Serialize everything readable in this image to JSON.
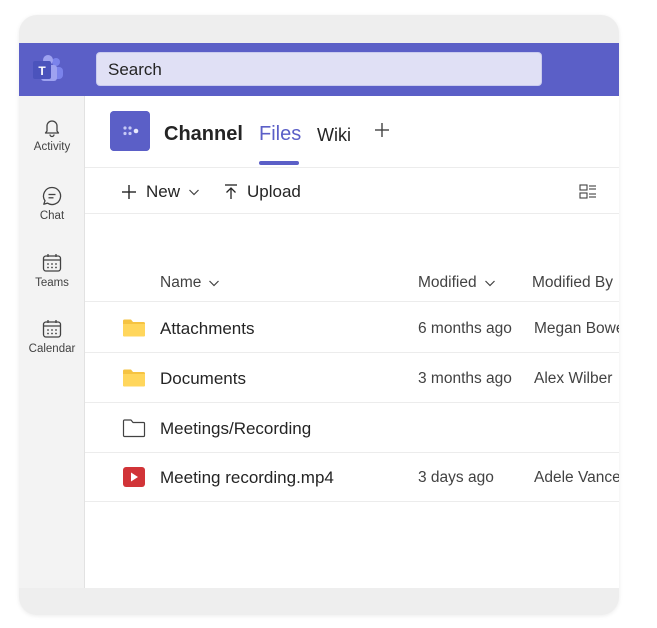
{
  "search": {
    "placeholder": "Search"
  },
  "rail": [
    {
      "label": "Activity",
      "icon": "bell-icon"
    },
    {
      "label": "Chat",
      "icon": "chat-icon"
    },
    {
      "label": "Teams",
      "icon": "teams-icon"
    },
    {
      "label": "Calendar",
      "icon": "calendar-icon"
    }
  ],
  "header": {
    "channel": "Channel",
    "tabs": [
      {
        "label": "Files",
        "active": true
      },
      {
        "label": "Wiki",
        "active": false
      }
    ]
  },
  "toolbar": {
    "new_label": "New",
    "upload_label": "Upload"
  },
  "columns": {
    "name": "Name",
    "modified": "Modified",
    "modified_by": "Modified By"
  },
  "files": [
    {
      "icon": "folder-icon",
      "name": "Attachments",
      "modified": "6 months ago",
      "modified_by": "Megan Bowen"
    },
    {
      "icon": "folder-icon",
      "name": "Documents",
      "modified": "3 months ago",
      "modified_by": "Alex Wilber"
    },
    {
      "icon": "folder-outline-icon",
      "name": "Meetings/Recording",
      "modified": "",
      "modified_by": ""
    },
    {
      "icon": "video-file-icon",
      "name": "Meeting recording.mp4",
      "modified": "3 days ago",
      "modified_by": "Adele Vance"
    }
  ],
  "colors": {
    "accent": "#5b5fc7",
    "folder": "#f5c342",
    "video": "#d13438"
  }
}
